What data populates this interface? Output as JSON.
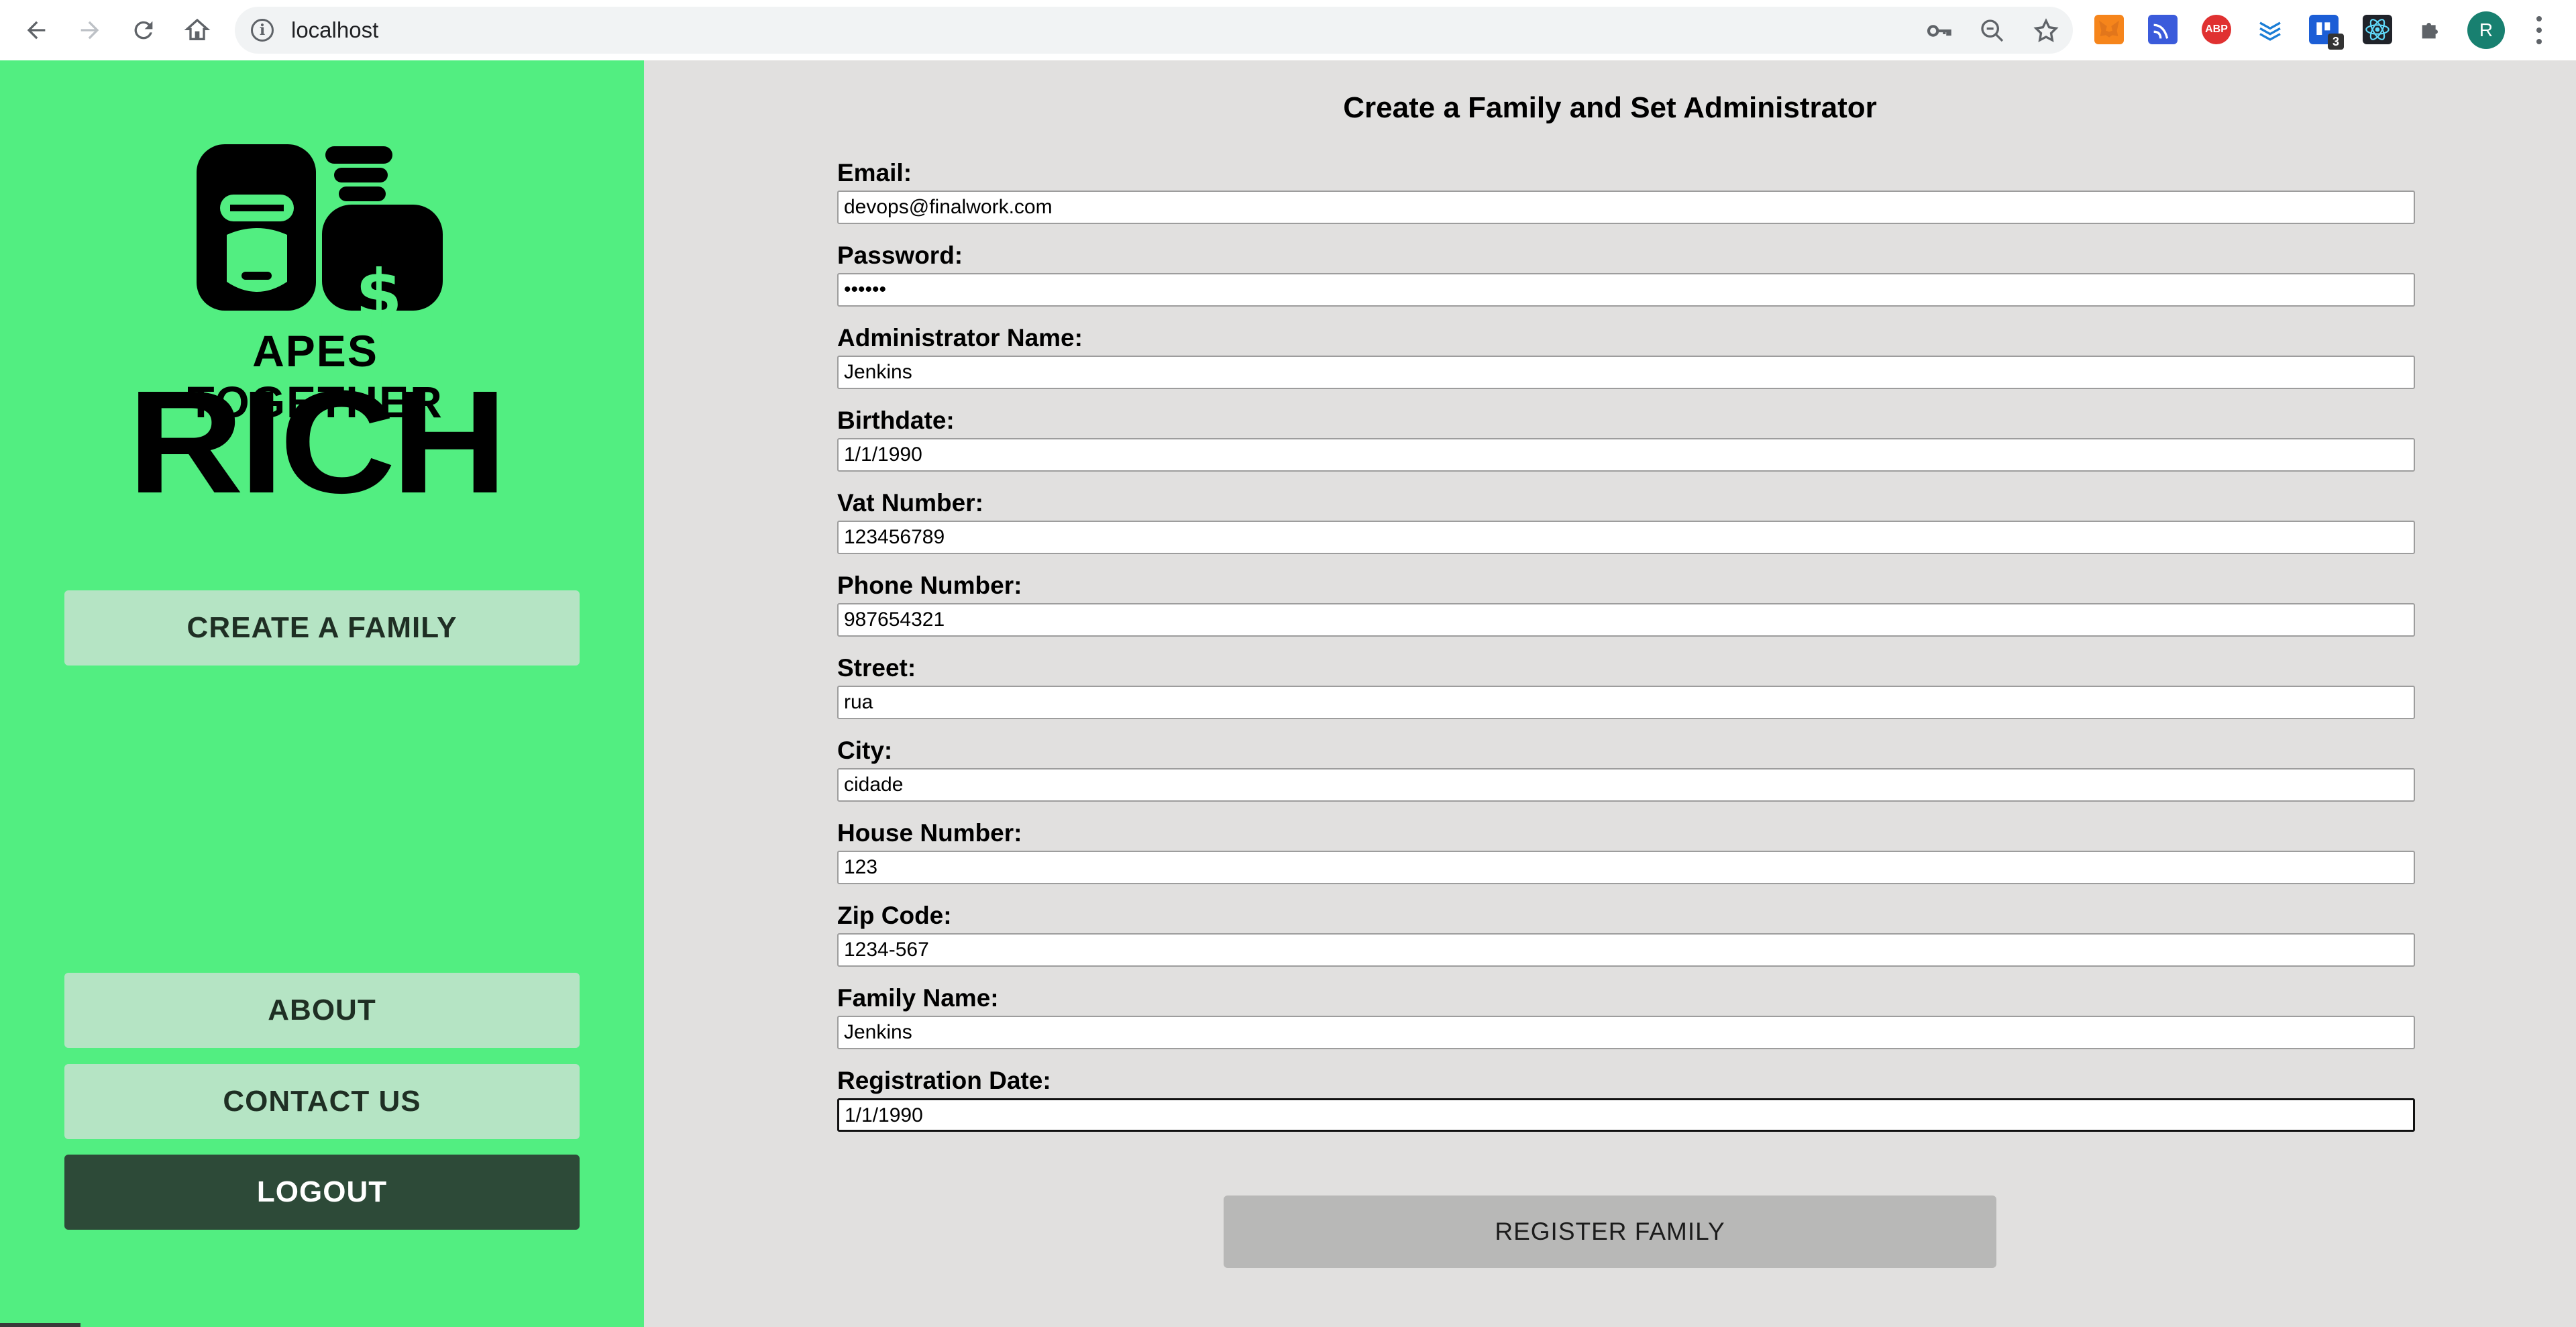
{
  "browser": {
    "url": "localhost",
    "extension_badge": "3",
    "profile_initial": "R",
    "adblock_label": "ABP"
  },
  "sidebar": {
    "logo_line1": "APES TOGETHER",
    "logo_line2": "RICH",
    "logo_symbol": "$",
    "buttons": {
      "create": "CREATE A FAMILY",
      "about": "ABOUT",
      "contact": "CONTACT US",
      "logout": "LOGOUT"
    }
  },
  "form": {
    "title": "Create a Family and Set Administrator",
    "fields": [
      {
        "label": "Email:",
        "value": "devops@finalwork.com"
      },
      {
        "label": "Password:",
        "value": "••••••"
      },
      {
        "label": "Administrator Name:",
        "value": "Jenkins"
      },
      {
        "label": "Birthdate:",
        "value": "1/1/1990"
      },
      {
        "label": "Vat Number:",
        "value": "123456789"
      },
      {
        "label": "Phone Number:",
        "value": "987654321"
      },
      {
        "label": "Street:",
        "value": "rua"
      },
      {
        "label": "City:",
        "value": "cidade"
      },
      {
        "label": "House Number:",
        "value": "123"
      },
      {
        "label": "Zip Code:",
        "value": "1234-567"
      },
      {
        "label": "Family Name:",
        "value": "Jenkins"
      },
      {
        "label": "Registration Date:",
        "value": "1/1/1990"
      }
    ],
    "submit_label": "REGISTER FAMILY"
  },
  "colors": {
    "sidebar_bg": "#52ee81",
    "side_button": "#b5e4c4",
    "logout_button": "#2d4a38",
    "main_bg": "#e1e0df",
    "register_button": "#b8b8b7"
  }
}
